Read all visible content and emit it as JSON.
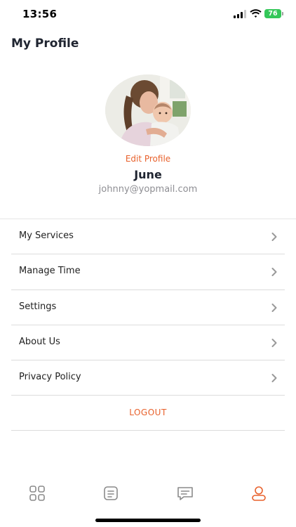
{
  "status_bar": {
    "time": "13:56",
    "battery": "76"
  },
  "header": {
    "title": "My Profile"
  },
  "profile": {
    "edit_label": "Edit Profile",
    "name": "June",
    "email": "johnny@yopmail.com"
  },
  "menu": {
    "items": [
      {
        "label": "My Services"
      },
      {
        "label": "Manage Time"
      },
      {
        "label": "Settings"
      },
      {
        "label": "About Us"
      },
      {
        "label": "Privacy Policy"
      }
    ],
    "logout_label": "LOGOUT"
  },
  "tab_bar": {
    "tabs": [
      {
        "icon": "grid-icon",
        "active": false
      },
      {
        "icon": "bookings-icon",
        "active": false
      },
      {
        "icon": "chat-icon",
        "active": false
      },
      {
        "icon": "profile-icon",
        "active": true
      }
    ],
    "active_color": "#e8612c",
    "inactive_color": "#8a8a8a"
  },
  "colors": {
    "accent": "#e8612c",
    "battery": "#34c759"
  }
}
